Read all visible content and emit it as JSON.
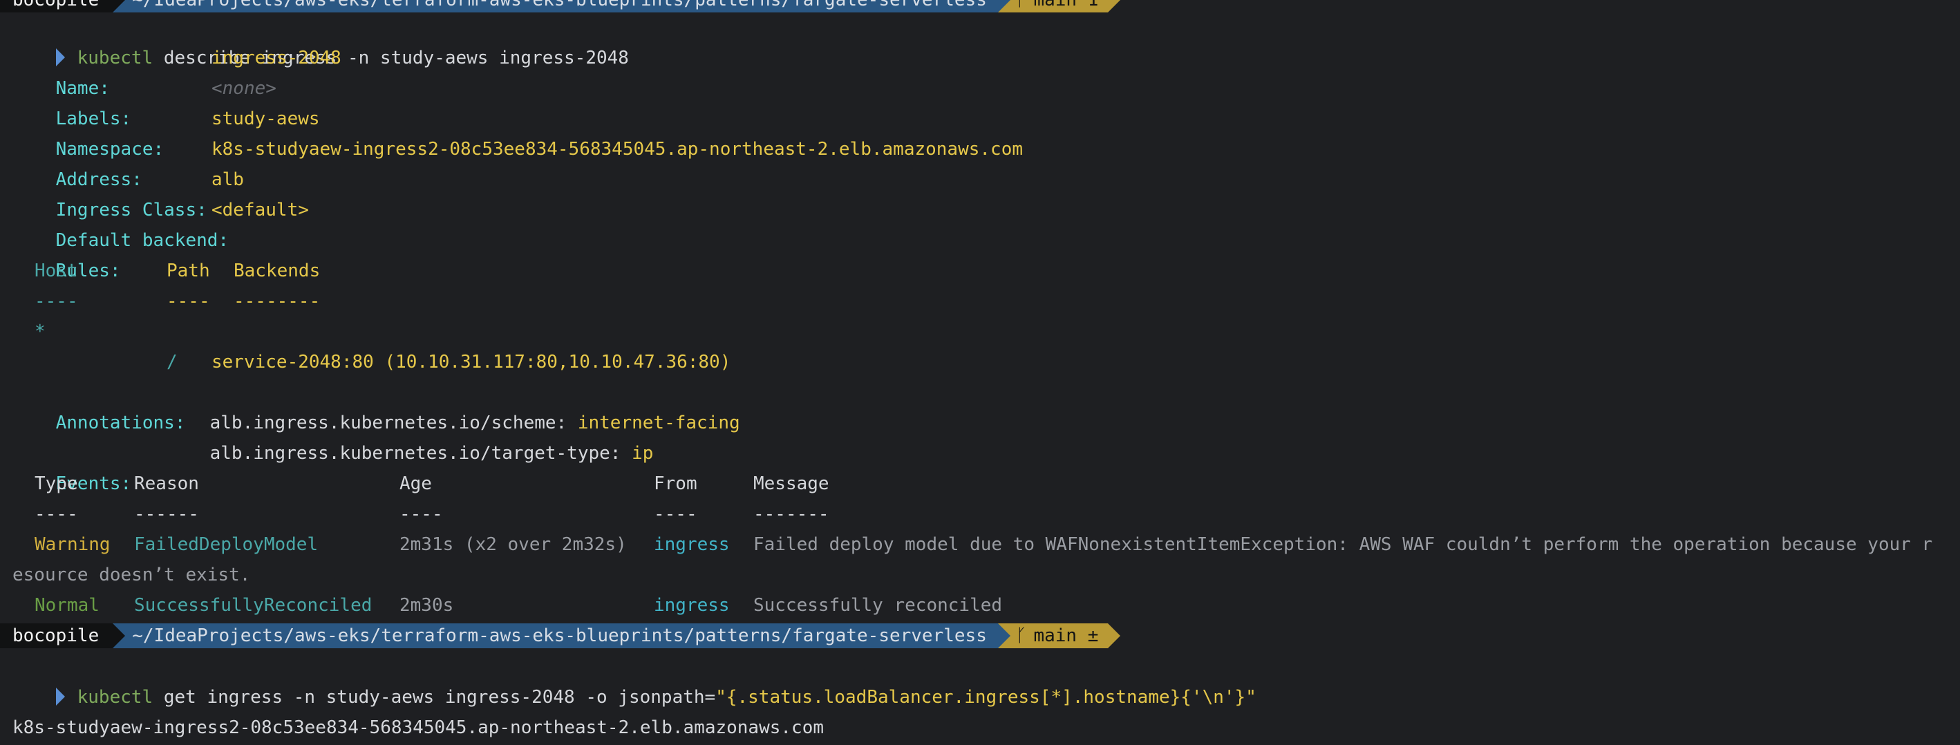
{
  "prompt_top": {
    "user": "bocopile",
    "path": "~/IdeaProjects/aws-eks/terraform-aws-eks-blueprints/patterns/fargate-serverless",
    "branch": "main 1"
  },
  "cmd1": {
    "program": "kubectl",
    "args": " describe ingress -n study-aews ingress-2048"
  },
  "describe": {
    "name_key": "Name:",
    "name_val": "ingress-2048",
    "labels_key": "Labels:",
    "labels_val": "<none>",
    "namespace_key": "Namespace:",
    "namespace_val": "study-aews",
    "address_key": "Address:",
    "address_val": "k8s-studyaew-ingress2-08c53ee834-568345045.ap-northeast-2.elb.amazonaws.com",
    "class_key": "Ingress Class:",
    "class_val": "alb",
    "backend_key": "Default backend:",
    "backend_val": "<default>",
    "rules_key": "Rules:",
    "rules_head_host": "Host",
    "rules_head_path": "Path",
    "rules_head_backends": "Backends",
    "rules_sep_host": "----",
    "rules_sep_path": "----",
    "rules_sep_backends": "--------",
    "rules_host": "*",
    "rules_path": "/",
    "rules_backend": "service-2048:80 (10.10.31.117:80,10.10.47.36:80)",
    "annotations_key": "Annotations:",
    "ann1_key": "alb.ingress.kubernetes.io/scheme: ",
    "ann1_val": "internet-facing",
    "ann2_key": "alb.ingress.kubernetes.io/target-type: ",
    "ann2_val": "ip",
    "events_key": "Events:",
    "events_head": {
      "type": "Type",
      "reason": "Reason",
      "age": "Age",
      "from": "From",
      "message": "Message"
    },
    "events_sep": {
      "type": "----",
      "reason": "------",
      "age": "----",
      "from": "----",
      "message": "-------"
    },
    "events": [
      {
        "type": "Warning",
        "reason": "FailedDeployModel",
        "age": "2m31s (x2 over 2m32s)",
        "from": "ingress",
        "message": "Failed deploy model due to WAFNonexistentItemException: AWS WAF couldn’t perform the operation because your r",
        "message_wrap": "esource doesn’t exist."
      },
      {
        "type": "Normal",
        "reason": "SuccessfullyReconciled",
        "age": "2m30s",
        "from": "ingress",
        "message": "Successfully reconciled"
      }
    ]
  },
  "prompt_bottom": {
    "user": "bocopile",
    "path": "~/IdeaProjects/aws-eks/terraform-aws-eks-blueprints/patterns/fargate-serverless",
    "branch": "main ±"
  },
  "cmd2": {
    "program": "kubectl",
    "args": " get ingress -n study-aews ingress-2048 -o jsonpath=",
    "jsonpath": "\"{.status.loadBalancer.ingress[*].hostname}{'\\n'}\""
  },
  "output": "k8s-studyaew-ingress2-08c53ee834-568345045.ap-northeast-2.elb.amazonaws.com",
  "icons": {
    "prompt_caret": "caret-right-icon",
    "git_branch": "git-branch-icon"
  },
  "colors": {
    "background": "#1e1f22",
    "key": "#5fd7d7",
    "value": "#e6c84a",
    "path_segment": "#2a5783",
    "git_segment": "#b99a35"
  }
}
